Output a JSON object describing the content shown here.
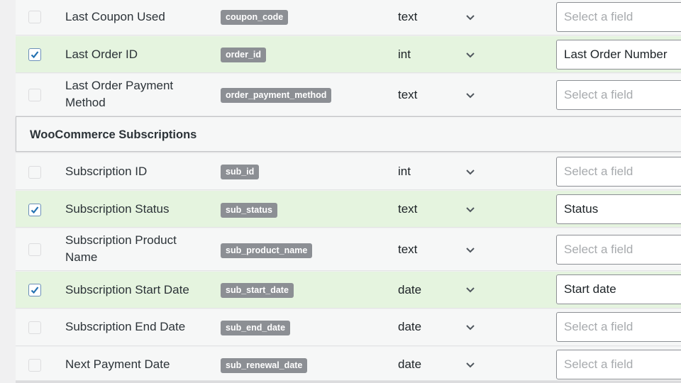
{
  "rows_top": [
    {
      "label": "Last Coupon Used",
      "key": "coupon_code",
      "type": "text",
      "field": "Select a field",
      "checked": false
    },
    {
      "label": "Last Order ID",
      "key": "order_id",
      "type": "int",
      "field": "Last Order Number",
      "checked": true
    },
    {
      "label": "Last Order Payment Method",
      "key": "order_payment_method",
      "type": "text",
      "field": "Select a field",
      "checked": false
    }
  ],
  "section": {
    "title": "WooCommerce Subscriptions"
  },
  "rows_sub": [
    {
      "label": "Subscription ID",
      "key": "sub_id",
      "type": "int",
      "field": "Select a field",
      "checked": false
    },
    {
      "label": "Subscription Status",
      "key": "sub_status",
      "type": "text",
      "field": "Status",
      "checked": true
    },
    {
      "label": "Subscription Product Name",
      "key": "sub_product_name",
      "type": "text",
      "field": "Select a field",
      "checked": false
    },
    {
      "label": "Subscription Start Date",
      "key": "sub_start_date",
      "type": "date",
      "field": "Start date",
      "checked": true
    },
    {
      "label": "Subscription End Date",
      "key": "sub_end_date",
      "type": "date",
      "field": "Select a field",
      "checked": false
    },
    {
      "label": "Next Payment Date",
      "key": "sub_renewal_date",
      "type": "date",
      "field": "Select a field",
      "checked": false
    }
  ]
}
